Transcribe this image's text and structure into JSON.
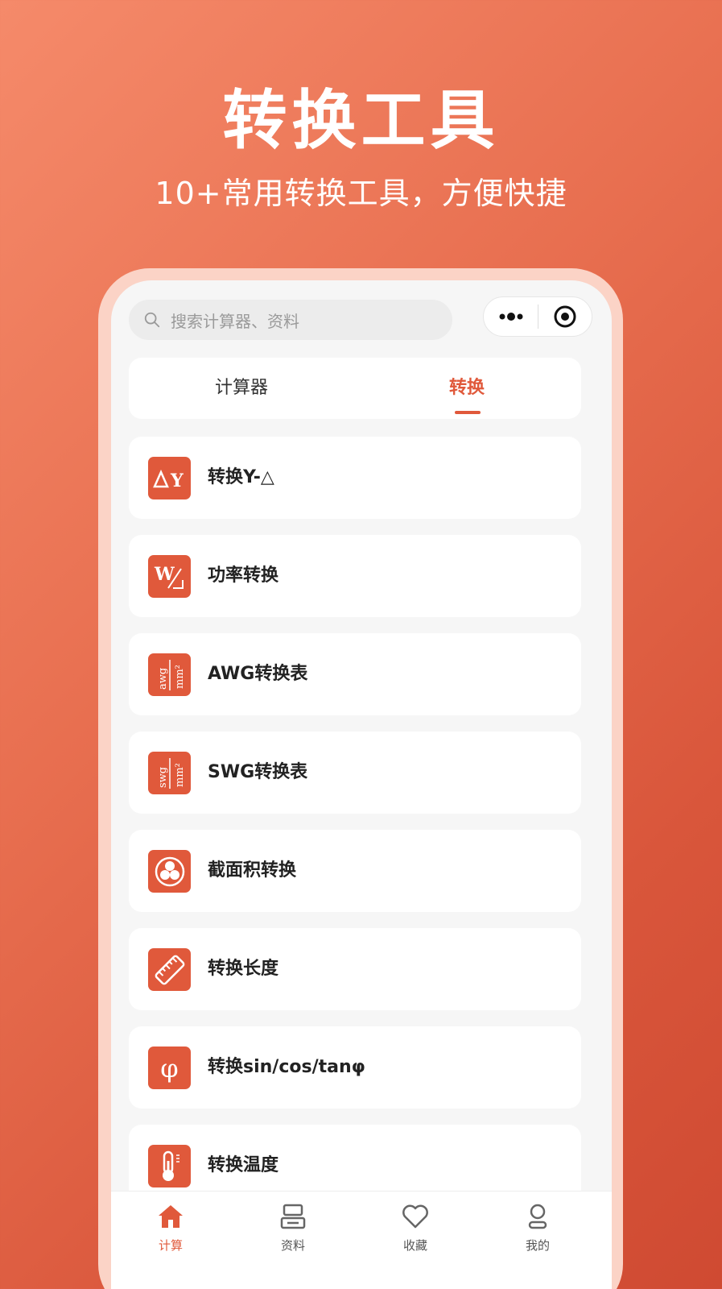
{
  "hero": {
    "title": "转换工具",
    "subtitle": "10+常用转换工具，方便快捷"
  },
  "search": {
    "placeholder": "搜索计算器、资料"
  },
  "tabs": {
    "calculator": "计算器",
    "convert": "转换",
    "active": "convert"
  },
  "items": [
    {
      "label": "转换Y-△",
      "icon": "delta-y-icon",
      "icon_text": "ΔY"
    },
    {
      "label": "功率转换",
      "icon": "power-w-icon",
      "icon_text": "W"
    },
    {
      "label": "AWG转换表",
      "icon": "awg-table-icon",
      "icon_text": "awg"
    },
    {
      "label": "SWG转换表",
      "icon": "swg-table-icon",
      "icon_text": "swg"
    },
    {
      "label": "截面积转换",
      "icon": "cross-section-icon",
      "icon_text": ""
    },
    {
      "label": "转换长度",
      "icon": "ruler-icon",
      "icon_text": ""
    },
    {
      "label": "转换sin/cos/tanφ",
      "icon": "phi-icon",
      "icon_text": "φ"
    },
    {
      "label": "转换温度",
      "icon": "thermometer-icon",
      "icon_text": ""
    }
  ],
  "tabbar": [
    {
      "label": "计算",
      "icon": "home-icon",
      "active": true
    },
    {
      "label": "资料",
      "icon": "document-icon",
      "active": false
    },
    {
      "label": "收藏",
      "icon": "heart-icon",
      "active": false
    },
    {
      "label": "我的",
      "icon": "user-icon",
      "active": false
    }
  ],
  "colors": {
    "accent": "#e0593b",
    "background_start": "#f58a6a",
    "background_end": "#cf4a32",
    "phone_frame": "#fbd3c6"
  }
}
